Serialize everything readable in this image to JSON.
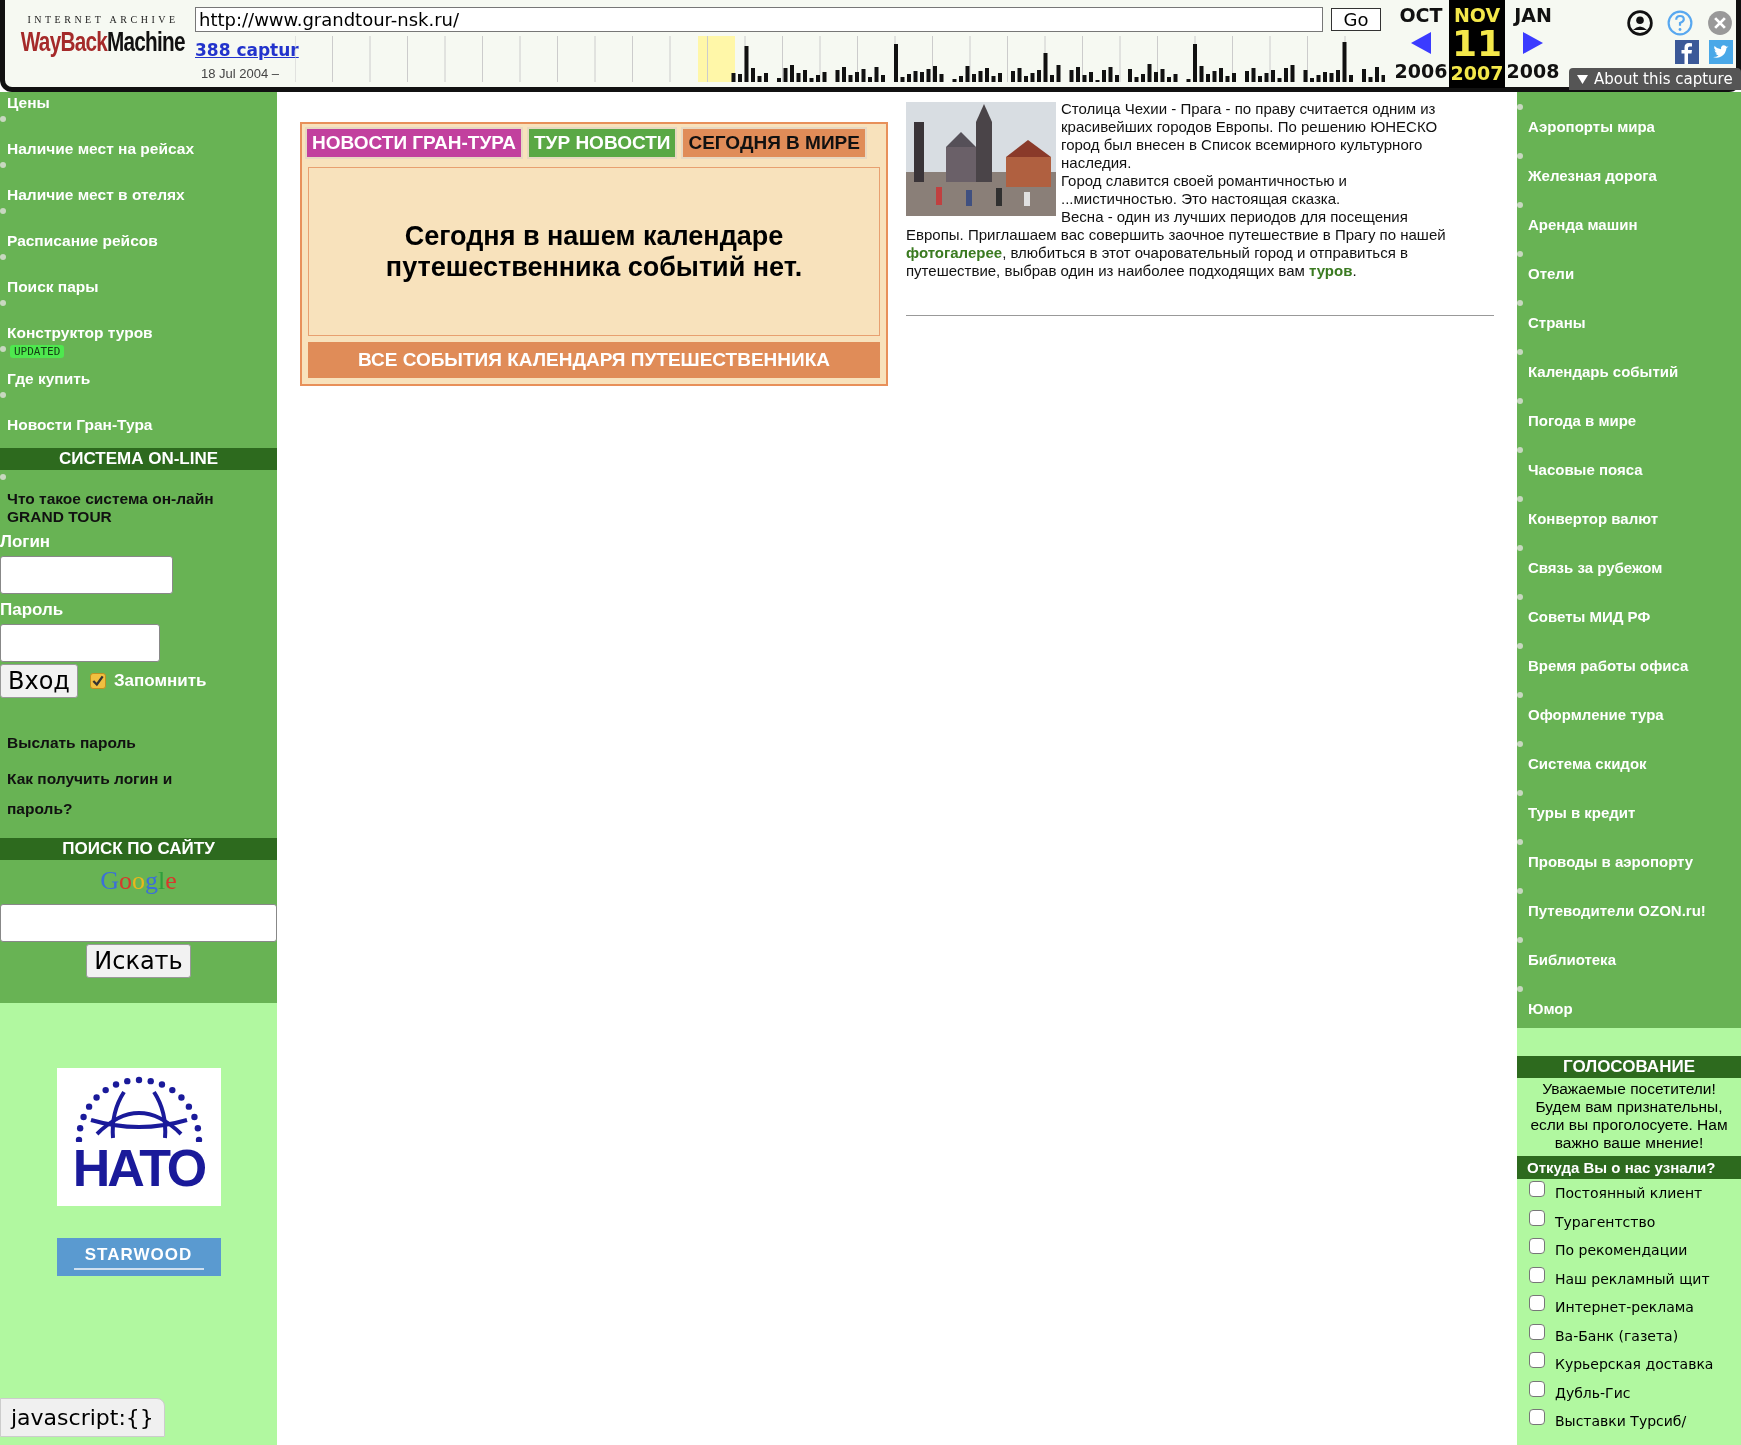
{
  "toolbar": {
    "logo_top": "INTERNET ARCHIVE",
    "logo_parts": [
      "WayBack",
      "Machine"
    ],
    "url": "http://www.grandtour-nsk.ru/",
    "go": "Go",
    "captures": "388 captur",
    "date_range": "18 Jul 2004 –",
    "months": [
      {
        "label": "OCT",
        "selected": false
      },
      {
        "label": "NOV",
        "selected": true
      },
      {
        "label": "JAN",
        "selected": false
      }
    ],
    "day": "11",
    "years": [
      {
        "label": "2006",
        "selected": false
      },
      {
        "label": "2007",
        "selected": true
      },
      {
        "label": "2008",
        "selected": false
      }
    ],
    "about": "About this capture"
  },
  "left_menu": [
    {
      "label": "Цены"
    },
    {
      "label": "Наличие мест на рейсах"
    },
    {
      "label": "Наличие мест в отелях"
    },
    {
      "label": "Расписание рейсов"
    },
    {
      "label": "Поиск пары"
    },
    {
      "label": "Конструктор туров",
      "badge": "UPDATED"
    },
    {
      "label": "Где купить"
    },
    {
      "label": "Новости Гран-Тура"
    }
  ],
  "online": {
    "title": "СИСТЕМА ON-LINE",
    "intro": "Что такое система он-лайн GRAND TOUR",
    "login_label": "Логин",
    "password_label": "Пароль",
    "submit": "Вход",
    "remember": {
      "label": "Запомнить",
      "checked": true
    },
    "links": [
      "Выслать пароль",
      "Как получить логин и пароль?"
    ]
  },
  "site_search": {
    "title": "ПОИСК ПО САЙТУ",
    "logo": "Google",
    "button": "Искать"
  },
  "partners": [
    {
      "kind": "nato",
      "label": "НАТО"
    },
    {
      "kind": "starwood",
      "label": "STARWOOD"
    }
  ],
  "tabs": [
    {
      "label": "НОВОСТИ ГРАН-ТУРА",
      "color": "#c2409e",
      "selected": false
    },
    {
      "label": "ТУР НОВОСТИ",
      "color": "#5aa845",
      "selected": false
    },
    {
      "label": "СЕГОДНЯ В МИРЕ",
      "color": "#e08c58",
      "selected": true
    }
  ],
  "calendar": {
    "message": "Сегодня в нашем календаре путешественника событий нет.",
    "button": "ВСЕ СОБЫТИЯ КАЛЕНДАРЯ ПУТЕШЕСТВЕННИКА"
  },
  "article": {
    "paragraphs": [
      "Столица Чехии - Прага - по праву считается одним из красивейших городов Европы. По решению ЮНЕСКО город был внесен в Список всемирного культурного наследия.",
      "Город славится своей романтичностью и ...мистичностью. Это настоящая сказка."
    ],
    "last": {
      "lead": "Весна - один из лучших периодов для посещения",
      "before": "Европы. Приглашаем вас совершить заочное путешествие в Прагу по нашей ",
      "link1": "фотогалерее",
      "middle": ", влюбиться в этот очаровательный город и отправиться в путешествие, выбрав один из наиболее подходящих вам ",
      "link2": "туров",
      "after": "."
    }
  },
  "right_menu": [
    {
      "label": "Аэропорты мира"
    },
    {
      "label": "Железная дорога"
    },
    {
      "label": "Аренда машин"
    },
    {
      "label": "Отели"
    },
    {
      "label": "Страны"
    },
    {
      "label": "Календарь событий"
    },
    {
      "label": "Погода в мире"
    },
    {
      "label": "Часовые пояса"
    },
    {
      "label": "Конвертор валют"
    },
    {
      "label": "Связь за рубежом"
    },
    {
      "label": "Советы МИД РФ"
    },
    {
      "label": "Время работы офиса"
    },
    {
      "label": "Оформление тура"
    },
    {
      "label": "Система скидок"
    },
    {
      "label": "Туры в кредит"
    },
    {
      "label": "Проводы в аэропорту"
    },
    {
      "label": "Путеводители OZON.ru!"
    },
    {
      "label": "Библиотека"
    },
    {
      "label": "Юмор"
    }
  ],
  "poll": {
    "title": "ГОЛОСОВАНИЕ",
    "intro": "Уважаемые посетители! Будем вам признательны, если вы проголосуете. Нам важно ваше мнение!",
    "question": "Откуда Вы о нас узнали?",
    "options": [
      {
        "label": "Постоянный клиент",
        "checked": false
      },
      {
        "label": "Турагентство",
        "checked": false
      },
      {
        "label": "По рекомендации",
        "checked": false
      },
      {
        "label": "Наш рекламный щит",
        "checked": false
      },
      {
        "label": "Интернет-реклама",
        "checked": false
      },
      {
        "label": "Ва-Банк (газета)",
        "checked": false
      },
      {
        "label": "Курьерская доставка",
        "checked": false
      },
      {
        "label": "Дубль-Гис",
        "checked": false
      },
      {
        "label": "Выставки Турсиб/",
        "checked": false
      }
    ]
  },
  "status_tooltip": "javascript:{}"
}
